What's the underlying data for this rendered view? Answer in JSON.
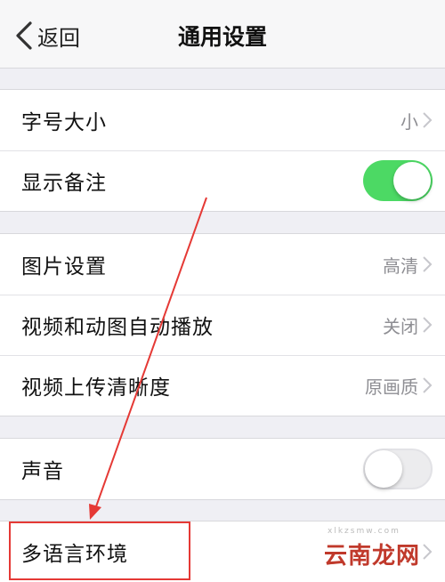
{
  "navbar": {
    "back_label": "返回",
    "title": "通用设置"
  },
  "group1": {
    "font_size": {
      "label": "字号大小",
      "value": "小"
    },
    "show_notes": {
      "label": "显示备注",
      "switch": "on"
    }
  },
  "group2": {
    "image_settings": {
      "label": "图片设置",
      "value": "高清"
    },
    "video_autoplay": {
      "label": "视频和动图自动播放",
      "value": "关闭"
    },
    "video_upload": {
      "label": "视频上传清晰度",
      "value": "原画质"
    }
  },
  "group3": {
    "sound": {
      "label": "声音",
      "switch": "off"
    }
  },
  "group4": {
    "multi_language": {
      "label": "多语言环境"
    }
  },
  "watermark": {
    "text": "云南龙网",
    "sub": "xlkzsmw.com"
  },
  "colors": {
    "switch_on": "#4cd964",
    "annotation": "#e53935",
    "background": "#efeff4"
  }
}
